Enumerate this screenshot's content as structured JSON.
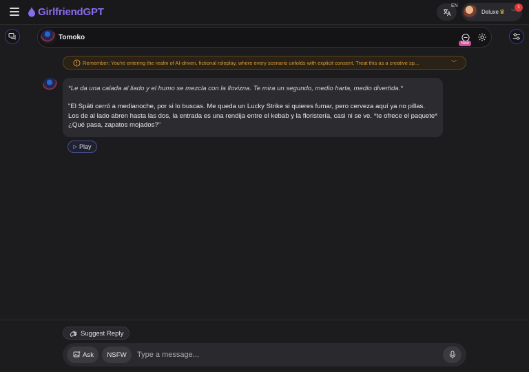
{
  "header": {
    "logo_text": "GirlfriendGPT",
    "language_code": "EN",
    "profile": {
      "plan_label": "Deluxe",
      "notification_count": "1"
    }
  },
  "character": {
    "name": "Tomoko",
    "chat_new_badge": "New"
  },
  "disclaimer": {
    "text": "Remember: You're entering the realm of AI-driven, fictional roleplay, where every scenario unfolds with explicit consent. Treat this as a creative sp..."
  },
  "message": {
    "action": "*Le da una calada al liado y el humo se mezcla con la llovizna. Te mira un segundo, medio harta, medio divertida.*",
    "text": "\"El Späti cerró a medianoche, por si lo buscas. Me queda un Lucky Strike si quieres fumar, pero cerveza aquí ya no pillas. Los de al lado abren hasta las dos, la entrada es una rendija entre el kebab y la floristería, casi ni se ve. *te ofrece el paquete* ¿Qué pasa, zapatos mojados?\"",
    "play_label": "Play"
  },
  "composer": {
    "suggest_label": "Suggest Reply",
    "ask_label": "Ask",
    "nsfw_label": "NSFW",
    "input_value": "",
    "input_placeholder": "Type a message..."
  },
  "icons": {
    "menu": "hamburger-icon",
    "logo": "flame-drop-icon",
    "translate": "translate-icon",
    "crown": "crown-icon",
    "chats": "chat-bubbles-icon",
    "filters": "sliders-icon",
    "settings": "gear-icon",
    "info": "info-circle-icon",
    "play": "play-icon",
    "suggest": "hand-wave-icon",
    "ask": "image-sparkle-icon",
    "mic": "microphone-icon"
  },
  "colors": {
    "brand": "#8a6cf0",
    "warning": "#d99b3a",
    "badge": "#d93a3a",
    "new_badge": "#d14e9a"
  }
}
